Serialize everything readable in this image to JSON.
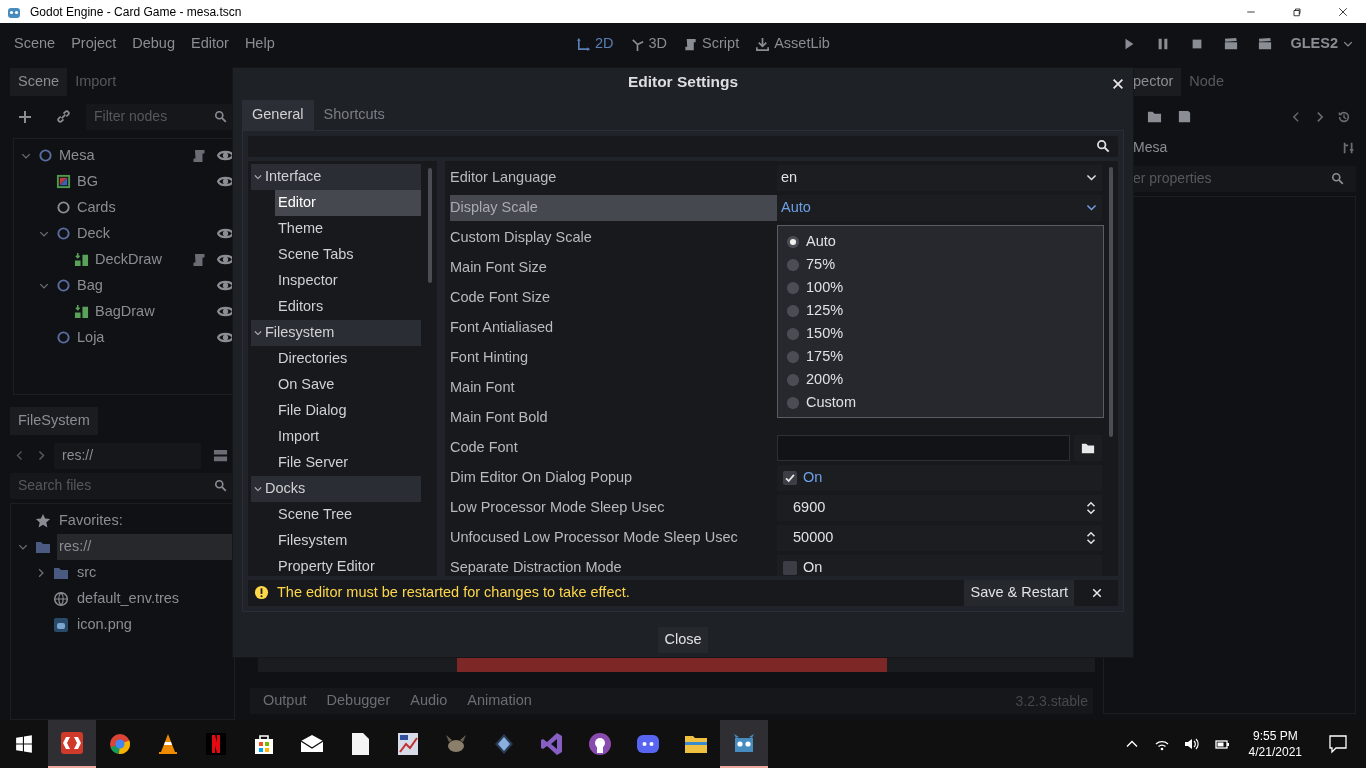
{
  "window": {
    "title": "Godot Engine - Card Game - mesa.tscn"
  },
  "menu": [
    "Scene",
    "Project",
    "Debug",
    "Editor",
    "Help"
  ],
  "workspaces": [
    {
      "label": "2D",
      "kind": "canvas",
      "selected": true
    },
    {
      "label": "3D",
      "kind": "spatial",
      "selected": false
    },
    {
      "label": "Script",
      "kind": "script",
      "selected": false
    },
    {
      "label": "AssetLib",
      "kind": "assetlib",
      "selected": false
    }
  ],
  "renderer": "GLES2",
  "scene_dock": {
    "tabs": [
      {
        "label": "Scene",
        "selected": true
      },
      {
        "label": "Import",
        "selected": false
      }
    ],
    "filter": {
      "placeholder": "Filter nodes"
    },
    "tree": [
      {
        "name": "Mesa",
        "kind": "node2d",
        "script": true,
        "eye": true,
        "expanded": true,
        "children": [
          {
            "name": "BG",
            "kind": "colorrect",
            "script": false,
            "eye": true
          },
          {
            "name": "Cards",
            "kind": "node",
            "script": false,
            "eye": false
          },
          {
            "name": "Deck",
            "kind": "node2d",
            "script": false,
            "eye": true,
            "expanded": true,
            "children": [
              {
                "name": "DeckDraw",
                "kind": "instance",
                "script": true,
                "eye": true
              }
            ]
          },
          {
            "name": "Bag",
            "kind": "node2d",
            "script": false,
            "eye": true,
            "expanded": true,
            "children": [
              {
                "name": "BagDraw",
                "kind": "instance",
                "script": false,
                "eye": true
              }
            ]
          },
          {
            "name": "Loja",
            "kind": "node2d",
            "script": false,
            "eye": true
          }
        ]
      }
    ]
  },
  "filesystem": {
    "tab": "FileSystem",
    "path": "res://",
    "search": {
      "placeholder": "Search files"
    },
    "items": [
      {
        "label": "Favorites:",
        "kind": "star",
        "selected": false
      },
      {
        "label": "res://",
        "kind": "folder",
        "selected": true,
        "expanded": true,
        "children": [
          {
            "label": "src",
            "kind": "folder",
            "selected": false,
            "expanded": false
          },
          {
            "label": "default_env.tres",
            "kind": "resource",
            "selected": false
          },
          {
            "label": "icon.png",
            "kind": "image",
            "selected": false
          }
        ]
      }
    ]
  },
  "inspector": {
    "tabs": [
      {
        "label": "pector",
        "selected": true
      },
      {
        "label": "Node",
        "selected": false
      }
    ],
    "object": "Mesa",
    "filter": {
      "placeholder": "er properties"
    }
  },
  "bottom_panel": {
    "tabs": [
      "Output",
      "Debugger",
      "Audio",
      "Animation"
    ],
    "version": "3.2.3.stable"
  },
  "dialog": {
    "title": "Editor Settings",
    "tabs": [
      {
        "label": "General",
        "selected": true
      },
      {
        "label": "Shortcuts",
        "selected": false
      }
    ],
    "sections": [
      {
        "label": "Interface",
        "selected": false,
        "expanded": true,
        "children": [
          {
            "label": "Editor",
            "selected": true
          },
          {
            "label": "Theme",
            "selected": false
          },
          {
            "label": "Scene Tabs",
            "selected": false
          },
          {
            "label": "Inspector",
            "selected": false
          },
          {
            "label": "Editors",
            "selected": false
          }
        ]
      },
      {
        "label": "Filesystem",
        "selected": false,
        "expanded": true,
        "children": [
          {
            "label": "Directories",
            "selected": false
          },
          {
            "label": "On Save",
            "selected": false
          },
          {
            "label": "File Dialog",
            "selected": false
          },
          {
            "label": "Import",
            "selected": false
          },
          {
            "label": "File Server",
            "selected": false
          }
        ]
      },
      {
        "label": "Docks",
        "selected": false,
        "expanded": true,
        "children": [
          {
            "label": "Scene Tree",
            "selected": false
          },
          {
            "label": "Filesystem",
            "selected": false
          },
          {
            "label": "Property Editor",
            "selected": false
          }
        ]
      }
    ],
    "settings": [
      {
        "label": "Editor Language",
        "kind": "dropdown",
        "value": "en",
        "selected": false,
        "open": false
      },
      {
        "label": "Display Scale",
        "kind": "dropdown",
        "value": "Auto",
        "selected": true,
        "open": true
      },
      {
        "label": "Custom Display Scale",
        "kind": "none",
        "selected": false
      },
      {
        "label": "Main Font Size",
        "kind": "none",
        "selected": false
      },
      {
        "label": "Code Font Size",
        "kind": "none",
        "selected": false
      },
      {
        "label": "Font Antialiased",
        "kind": "none",
        "selected": false
      },
      {
        "label": "Font Hinting",
        "kind": "none",
        "selected": false
      },
      {
        "label": "Main Font",
        "kind": "none",
        "selected": false
      },
      {
        "label": "Main Font Bold",
        "kind": "none",
        "selected": false
      },
      {
        "label": "Code Font",
        "kind": "file",
        "selected": false
      },
      {
        "label": "Dim Editor On Dialog Popup",
        "kind": "check",
        "value": "On",
        "checked": true,
        "selected": false
      },
      {
        "label": "Low Processor Mode Sleep Usec",
        "kind": "spin",
        "value": "6900",
        "selected": false
      },
      {
        "label": "Unfocused Low Processor Mode Sleep Usec",
        "kind": "spin",
        "value": "50000",
        "selected": false
      },
      {
        "label": "Separate Distraction Mode",
        "kind": "check",
        "value": "On",
        "checked": false,
        "selected": false
      }
    ],
    "options": [
      {
        "label": "Auto",
        "selected": true
      },
      {
        "label": "75%",
        "selected": false
      },
      {
        "label": "100%",
        "selected": false
      },
      {
        "label": "125%",
        "selected": false
      },
      {
        "label": "150%",
        "selected": false
      },
      {
        "label": "175%",
        "selected": false
      },
      {
        "label": "200%",
        "selected": false
      },
      {
        "label": "Custom",
        "selected": false
      }
    ],
    "warning": "The editor must be restarted for changes to take effect.",
    "restart_button": "Save & Restart",
    "close_button": "Close"
  },
  "taskbar": {
    "apps": [
      {
        "kind": "dc",
        "active": true
      },
      {
        "kind": "browser",
        "active": false
      },
      {
        "kind": "cone",
        "active": false
      },
      {
        "kind": "stripe",
        "active": false
      },
      {
        "kind": "store",
        "active": false
      },
      {
        "kind": "mail",
        "active": false
      },
      {
        "kind": "document",
        "active": false
      },
      {
        "kind": "paint",
        "active": false
      },
      {
        "kind": "creature",
        "active": false
      },
      {
        "kind": "diamond",
        "active": false
      },
      {
        "kind": "ribbon",
        "active": false
      },
      {
        "kind": "octo",
        "active": false
      },
      {
        "kind": "chat",
        "active": false
      },
      {
        "kind": "folder",
        "active": false
      },
      {
        "kind": "robot",
        "active": true
      }
    ],
    "time": "9:55 PM",
    "date": "4/21/2021"
  }
}
